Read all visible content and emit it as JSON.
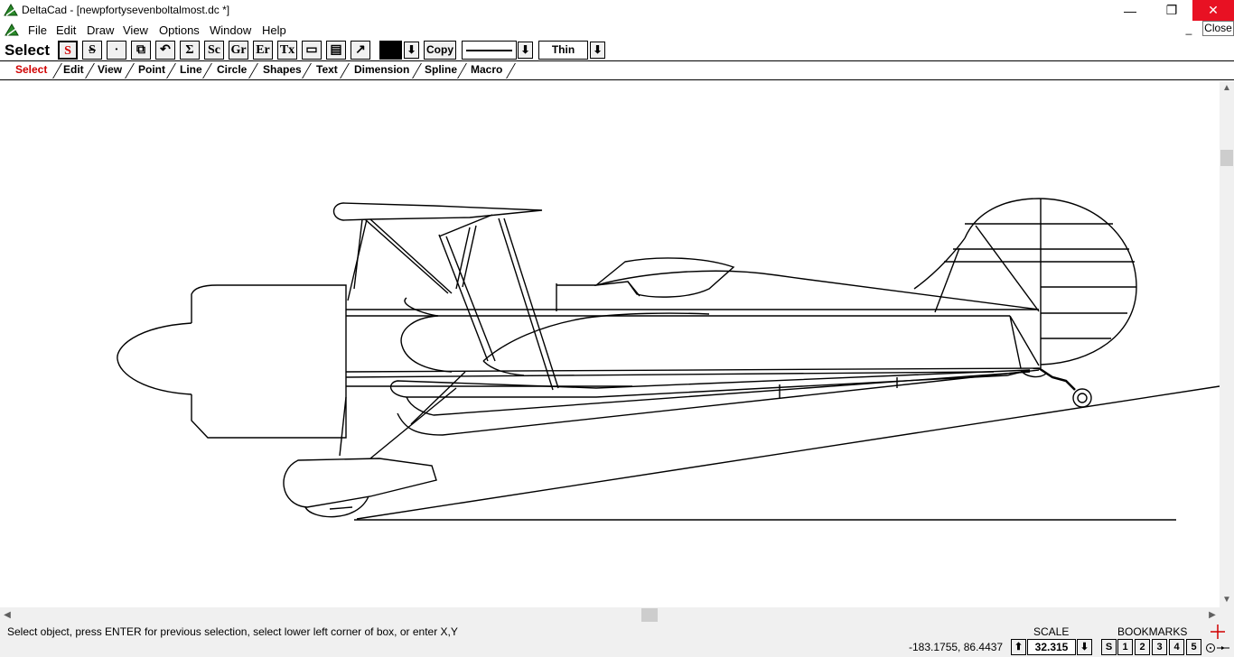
{
  "window": {
    "title": "DeltaCad - [newpfortysevenboltalmost.dc *]",
    "minimize": "—",
    "maximize": "❐",
    "close": "✕",
    "close_tooltip": "Close",
    "mdi_minimize": "_"
  },
  "menu": {
    "items": [
      "File",
      "Edit",
      "Draw",
      "View",
      "Options",
      "Window",
      "Help"
    ]
  },
  "toolbar": {
    "mode_label": "Select",
    "buttons": [
      "S",
      "S",
      "·",
      "⧉",
      "↶",
      "Σ",
      "Sc",
      "Gr",
      "Er",
      "Tx",
      "▭",
      "▤",
      "↗"
    ],
    "active_color": "#000000",
    "dropdown_arrow": "⬇",
    "copy_label": "Copy",
    "line_width": "Thin"
  },
  "tabs": {
    "items": [
      "Select",
      "Edit",
      "View",
      "Point",
      "Line",
      "Circle",
      "Shapes",
      "Text",
      "Dimension",
      "Spline",
      "Macro"
    ],
    "active": "Select",
    "active_color": "#d00000"
  },
  "scrollbars": {
    "up": "▲",
    "down": "▼",
    "left": "◀",
    "right": "▶"
  },
  "status": {
    "message": "Select object, press ENTER for previous selection, select lower left corner of box, or enter X,Y",
    "coordinates": "-183.1755, 86.4437",
    "scale_label": "SCALE",
    "scale_value": "32.315",
    "scale_up": "⬆",
    "scale_down": "⬇",
    "bookmarks_label": "BOOKMARKS",
    "bookmarks": [
      "S",
      "1",
      "2",
      "3",
      "4",
      "5"
    ]
  }
}
